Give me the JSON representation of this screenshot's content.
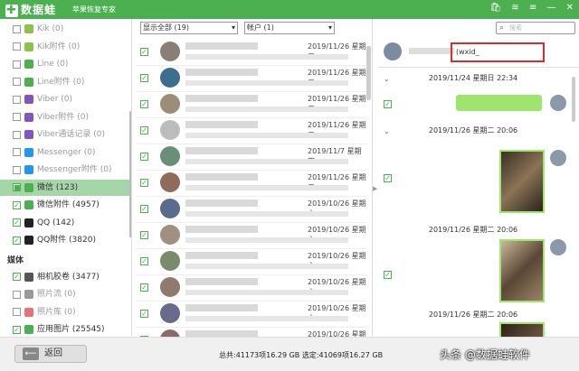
{
  "titlebar": {
    "app_name": "数据蛙",
    "subtitle": "苹果恢复专家"
  },
  "sidebar": {
    "items": [
      {
        "label": "Kik",
        "count": "(0)",
        "checked": false,
        "color": "#8bc34a",
        "icon": "kik-icon",
        "active": false
      },
      {
        "label": "Kik附件",
        "count": "(0)",
        "checked": false,
        "color": "#8bc34a",
        "icon": "kik-attachment-icon",
        "active": false
      },
      {
        "label": "Line",
        "count": "(0)",
        "checked": false,
        "color": "#4caf50",
        "icon": "line-icon",
        "active": false
      },
      {
        "label": "Line附件",
        "count": "(0)",
        "checked": false,
        "color": "#4caf50",
        "icon": "line-attachment-icon",
        "active": false
      },
      {
        "label": "Viber",
        "count": "(0)",
        "checked": false,
        "color": "#7e57c2",
        "icon": "viber-icon",
        "active": false
      },
      {
        "label": "Viber附件",
        "count": "(0)",
        "checked": false,
        "color": "#7e57c2",
        "icon": "viber-attachment-icon",
        "active": false
      },
      {
        "label": "Viber通话记录",
        "count": "(0)",
        "checked": false,
        "color": "#7e57c2",
        "icon": "viber-call-log-icon",
        "active": false
      },
      {
        "label": "Messenger",
        "count": "(0)",
        "checked": false,
        "color": "#2196f3",
        "icon": "messenger-icon",
        "active": false
      },
      {
        "label": "Messenger附件",
        "count": "(0)",
        "checked": false,
        "color": "#2196f3",
        "icon": "messenger-attachment-icon",
        "active": false
      },
      {
        "label": "微信",
        "count": "(123)",
        "checked": true,
        "color": "#4caf50",
        "icon": "wechat-icon",
        "active": true
      },
      {
        "label": "微信附件",
        "count": "(4957)",
        "checked": true,
        "color": "#4caf50",
        "icon": "wechat-attachment-icon",
        "active": false
      },
      {
        "label": "QQ",
        "count": "(142)",
        "checked": true,
        "color": "#222222",
        "icon": "qq-icon",
        "active": false
      },
      {
        "label": "QQ附件",
        "count": "(3820)",
        "checked": true,
        "color": "#222222",
        "icon": "qq-attachment-icon",
        "active": false
      }
    ],
    "media_header": "媒体",
    "media_items": [
      {
        "label": "相机胶卷",
        "count": "(3477)",
        "checked": true,
        "color": "#555555",
        "icon": "camera-roll-icon"
      },
      {
        "label": "照片流",
        "count": "(0)",
        "checked": false,
        "color": "#999999",
        "icon": "photo-stream-icon"
      },
      {
        "label": "照片库",
        "count": "(0)",
        "checked": false,
        "color": "#e57373",
        "icon": "photo-library-icon"
      },
      {
        "label": "应用图片",
        "count": "(25545)",
        "checked": true,
        "color": "#4caf50",
        "icon": "app-photos-icon"
      }
    ]
  },
  "filters": {
    "display_select": "显示全部 (19)",
    "account_select": "帐户 (1)"
  },
  "messages": [
    {
      "date": "2019/11/26",
      "weekday": "星期二",
      "checked": true,
      "avatar_color": "#8a7f76"
    },
    {
      "date": "2019/11/26",
      "weekday": "星期二",
      "checked": true,
      "avatar_color": "#3d6e8f"
    },
    {
      "date": "2019/11/26",
      "weekday": "星期二",
      "checked": true,
      "avatar_color": "#9c8c7a"
    },
    {
      "date": "2019/11/26",
      "weekday": "星期二",
      "checked": true,
      "avatar_color": "#bdbdbd"
    },
    {
      "date": "2019/11/7",
      "weekday": "星期四",
      "checked": true,
      "avatar_color": "#6b8e7a"
    },
    {
      "date": "2019/11/26",
      "weekday": "星期二",
      "checked": true,
      "avatar_color": "#8e6b5a"
    },
    {
      "date": "2019/10/26",
      "weekday": "星期六",
      "checked": true,
      "avatar_color": "#5a6b8e"
    },
    {
      "date": "2019/10/26",
      "weekday": "星期六",
      "checked": true,
      "avatar_color": "#a09080"
    },
    {
      "date": "2019/10/26",
      "weekday": "星期六",
      "checked": true,
      "avatar_color": "#7a8a6a"
    },
    {
      "date": "2019/10/26",
      "weekday": "星期六",
      "checked": true,
      "avatar_color": "#907a70"
    },
    {
      "date": "2019/10/26",
      "weekday": "星期六",
      "checked": true,
      "avatar_color": "#6a6a8a"
    },
    {
      "date": "2019/10/26",
      "weekday": "星期六",
      "checked": true,
      "avatar_color": "#8a6a6a"
    }
  ],
  "chat": {
    "search_placeholder": "搜索",
    "contact_id": "(wxid_",
    "date1": "2019/11/24 星期日 22:34",
    "date2": "2019/11/26 星期二 20:06",
    "date3": "2019/11/26 星期二 20:06",
    "date4": "2019/11/26 星期二 20:06"
  },
  "bottom": {
    "back_label": "返回",
    "status": "总共:41173项16.29 GB 选定:41069项16.27 GB",
    "watermark": "头条 @数据蛙软件"
  }
}
